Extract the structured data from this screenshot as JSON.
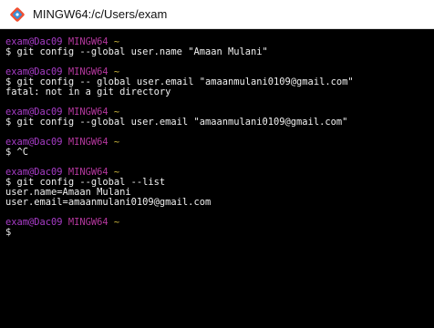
{
  "window": {
    "title": "MINGW64:/c/Users/exam",
    "icon": "git-diamond-icon"
  },
  "colors": {
    "background": "#000000",
    "prompt_user": "#a83cc8",
    "prompt_shell": "#b5379e",
    "prompt_dir": "#c8b33c",
    "text": "#f0f0f0"
  },
  "prompt": {
    "user_host": "exam@Dac09",
    "shell": "MINGW64",
    "dir": "~",
    "symbol": "$"
  },
  "blocks": [
    {
      "command": "git config --global user.name \"Amaan Mulani\"",
      "output": []
    },
    {
      "command": "git config -- global user.email \"amaanmulani0109@gmail.com\"",
      "output": [
        "fatal: not in a git directory"
      ]
    },
    {
      "command": "git config --global user.email \"amaanmulani0109@gmail.com\"",
      "output": []
    },
    {
      "command": "^C",
      "output": []
    },
    {
      "command": "git config --global --list",
      "output": [
        "user.name=Amaan Mulani",
        "user.email=amaanmulani0109@gmail.com"
      ]
    },
    {
      "command": "",
      "output": []
    }
  ]
}
